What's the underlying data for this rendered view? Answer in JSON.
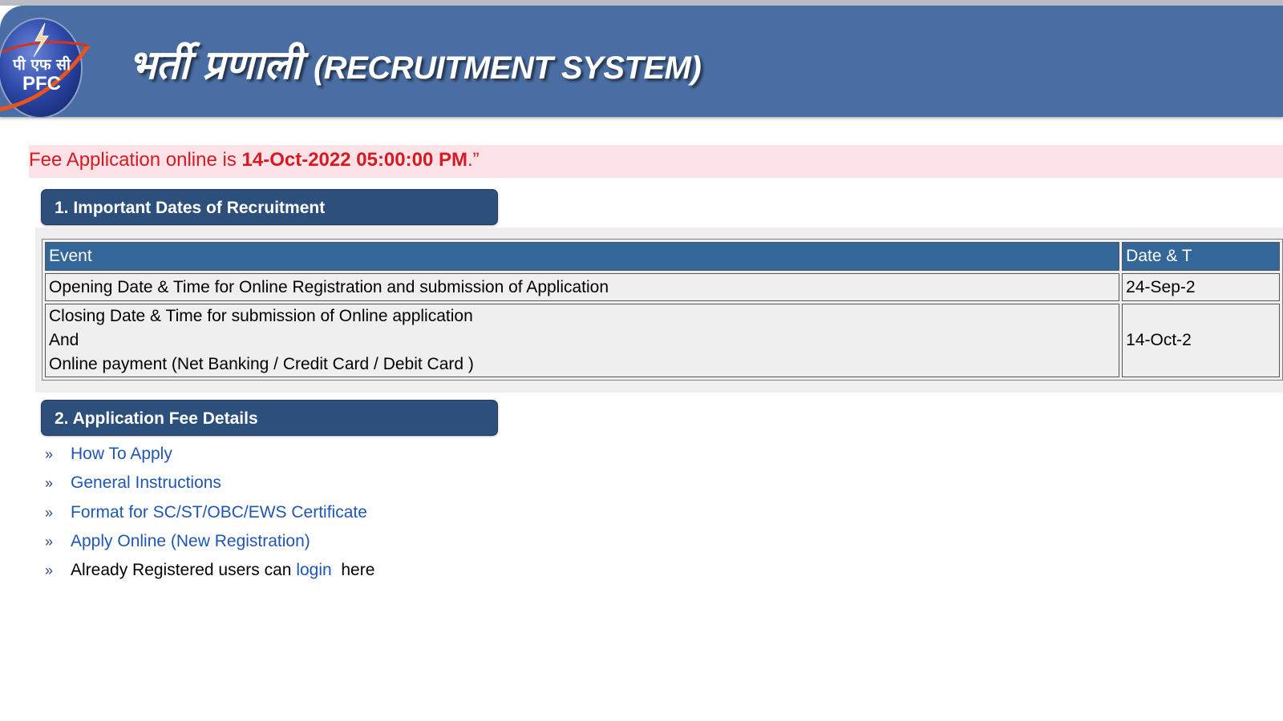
{
  "header": {
    "logo": {
      "hindi_text": "पी एफ सी",
      "english_text": "PFC",
      "icon": "lightning-bolt-icon"
    },
    "title_hindi": "भर्ती प्रणाली",
    "title_english": "(RECRUITMENT SYSTEM)"
  },
  "notice": {
    "prefix": "Fee Application online is ",
    "deadline": "14-Oct-2022 05:00:00 PM",
    "suffix": ".”"
  },
  "sections": [
    {
      "title": "1. Important Dates of Recruitment"
    },
    {
      "title": "2. Application Fee Details"
    }
  ],
  "dates_table": {
    "columns": [
      "Event",
      "Date & T"
    ],
    "rows": [
      {
        "event_lines": [
          "Opening Date & Time for Online Registration and submission of Application"
        ],
        "date": "24-Sep-2"
      },
      {
        "event_lines": [
          "Closing Date & Time for submission of Online application",
          "And",
          "Online payment (Net Banking / Credit Card / Debit Card )"
        ],
        "date": "14-Oct-2"
      }
    ]
  },
  "links": {
    "bullet": "»",
    "items": [
      {
        "label": "How To Apply"
      },
      {
        "label": "General Instructions"
      },
      {
        "label": "Format for SC/ST/OBC/EWS Certificate"
      },
      {
        "label": "Apply Online (New Registration)"
      }
    ],
    "login_line": {
      "before": "Already Registered users can ",
      "link": "login",
      "after": "  here"
    }
  }
}
